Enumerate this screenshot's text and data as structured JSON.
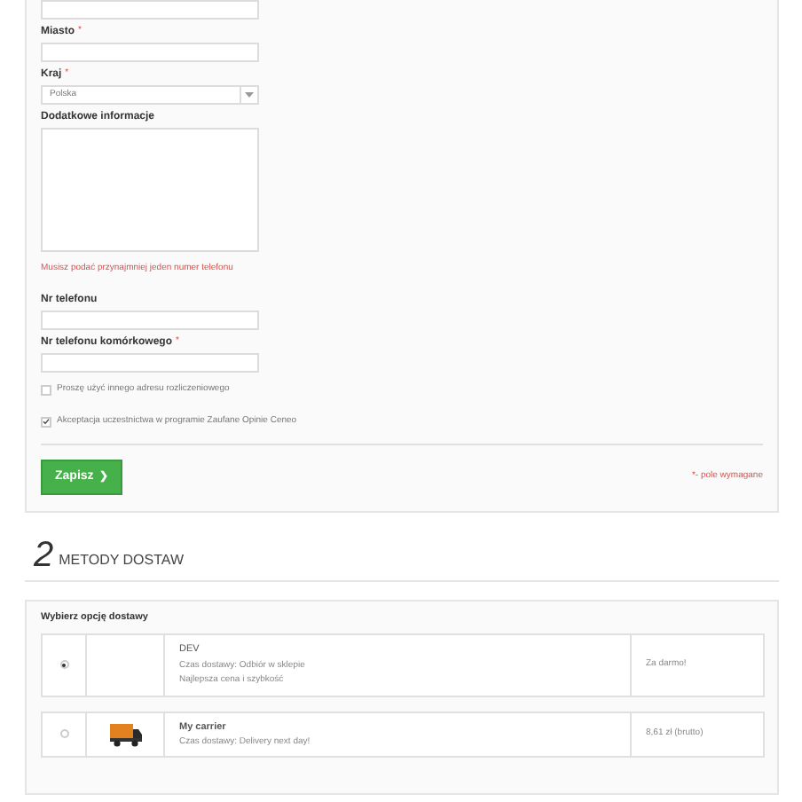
{
  "address_form": {
    "fields": [
      {
        "kind": "text"
      },
      {
        "kind": "text",
        "label": "Miasto",
        "required": true
      },
      {
        "kind": "select",
        "label": "Kraj",
        "required": true,
        "value": "Polska"
      },
      {
        "kind": "textarea",
        "label": "Dodatkowe informacje",
        "required": false
      }
    ],
    "error": "Musisz podać przynajmniej jeden numer telefonu",
    "phone_fields": [
      {
        "kind": "text",
        "label": "Nr telefonu",
        "required": false
      },
      {
        "kind": "text",
        "label": "Nr telefonu komórkowego",
        "required": true
      }
    ],
    "checkboxes": [
      {
        "label": "Proszę użyć innego adresu rozliczeniowego",
        "checked": false
      },
      {
        "label": "Akceptacja uczestnictwa w programie Zaufane Opinie Ceneo",
        "checked": true
      }
    ],
    "save_button": "Zapisz",
    "save_icon": "❯",
    "required_mark": "*",
    "required_note": "*- pole wymagane"
  },
  "shipping": {
    "step": "2",
    "title": "METODY DOSTAW",
    "prompt": "Wybierz opcję dostawy",
    "options": [
      {
        "name": "DEV",
        "lines": [
          "Czas dostawy: Odbiór w sklepie",
          "Najlepsza cena i szybkość"
        ],
        "price": "Za darmo!",
        "selected": true,
        "logo": false
      },
      {
        "name": "My carrier",
        "lines": [
          "Czas dostawy: Delivery next day!"
        ],
        "price": "8,61 zł (brutto)",
        "selected": false,
        "logo": true
      }
    ]
  }
}
